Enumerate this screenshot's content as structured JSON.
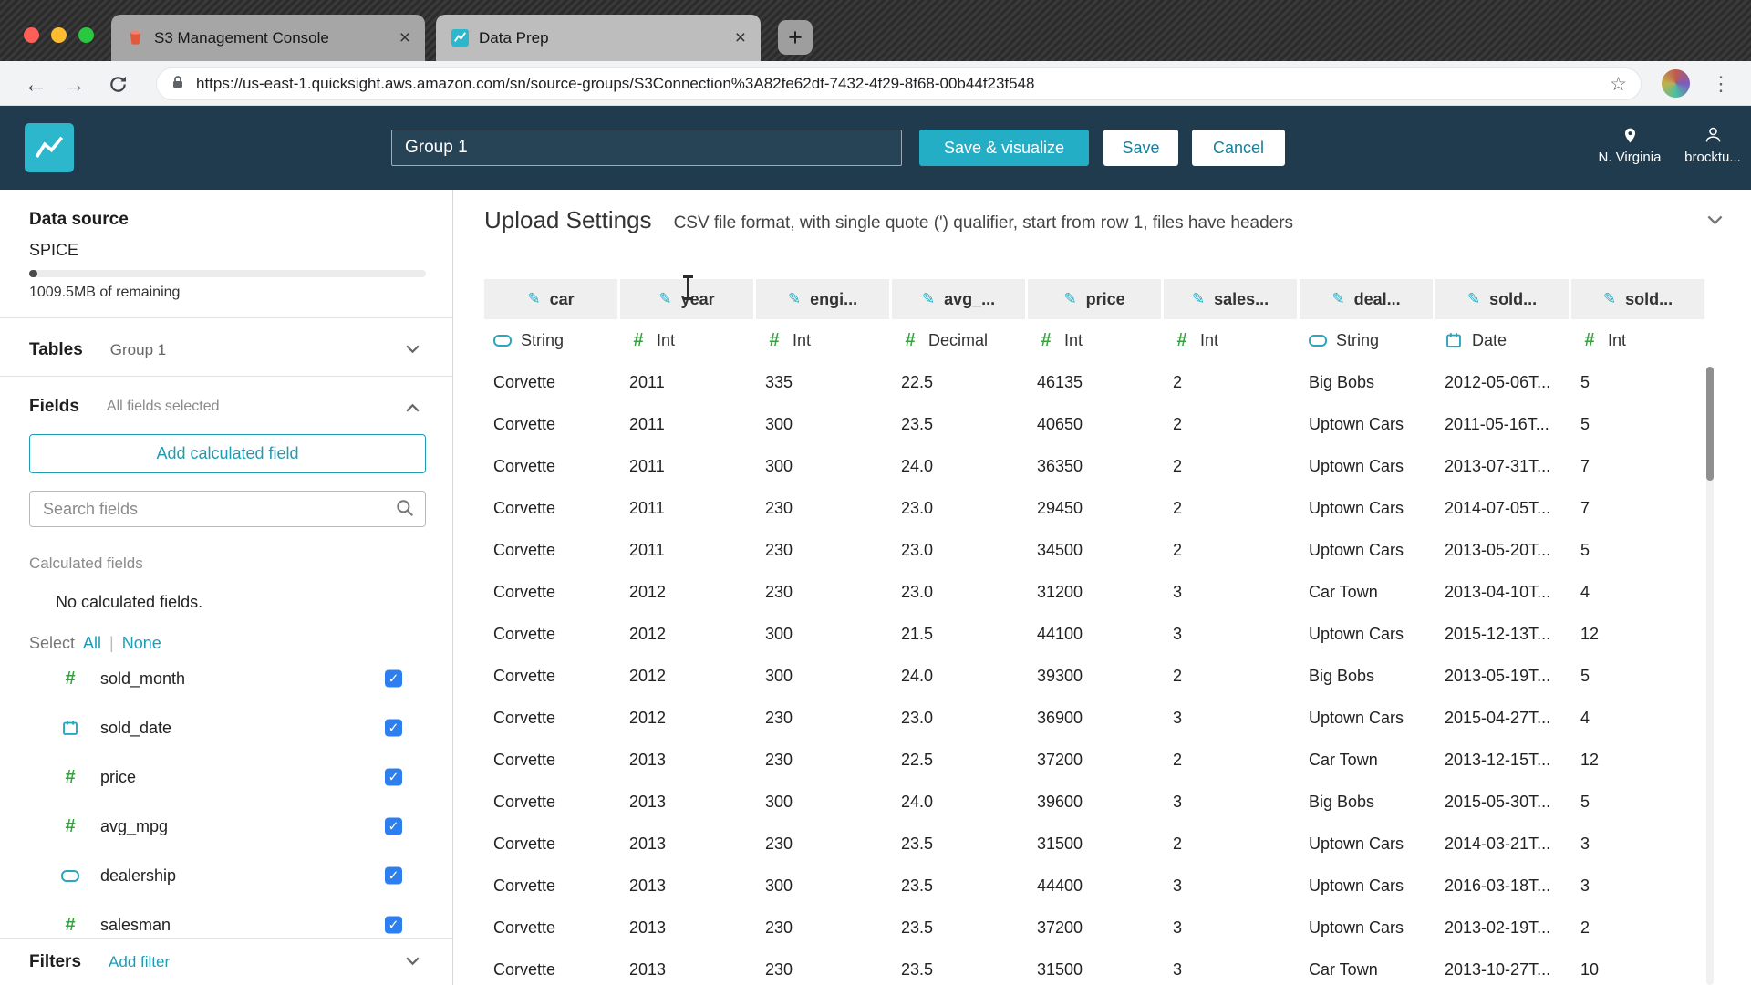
{
  "icons": {
    "close": "×",
    "plus": "+",
    "back": "←",
    "forward": "→",
    "kebab": "⋮",
    "star": "☆",
    "pencil": "✎",
    "check": "✓"
  },
  "browser": {
    "tabs": [
      {
        "label": "S3 Management Console"
      },
      {
        "label": "Data Prep"
      }
    ],
    "url": "https://us-east-1.quicksight.aws.amazon.com/sn/source-groups/S3Connection%3A82fe62df-7432-4f29-8f68-00b44f23f548"
  },
  "qs_header": {
    "group_name": "Group 1",
    "save_visualize": "Save & visualize",
    "save": "Save",
    "cancel": "Cancel",
    "region": "N. Virginia",
    "user": "brocktu..."
  },
  "sidebar": {
    "data_source_title": "Data source",
    "spice_label": "SPICE",
    "spice_remaining": "1009.5MB of remaining",
    "tables_label": "Tables",
    "tables_value": "Group 1",
    "fields_label": "Fields",
    "fields_status": "All fields selected",
    "add_calc_field": "Add calculated field",
    "search_placeholder": "Search fields",
    "calculated_fields_label": "Calculated fields",
    "no_calc_fields": "No calculated fields.",
    "select_label": "Select",
    "select_all": "All",
    "select_sep": "|",
    "select_none": "None",
    "fields": [
      {
        "name": "sold_month",
        "type": "int",
        "checked": true
      },
      {
        "name": "sold_date",
        "type": "date",
        "checked": true
      },
      {
        "name": "price",
        "type": "int",
        "checked": true
      },
      {
        "name": "avg_mpg",
        "type": "int",
        "checked": true
      },
      {
        "name": "dealership",
        "type": "string",
        "checked": true
      },
      {
        "name": "salesman",
        "type": "int",
        "checked": true
      }
    ],
    "filters_label": "Filters",
    "add_filter": "Add filter"
  },
  "main": {
    "title": "Upload Settings",
    "subtitle": "CSV file format, with single quote (') qualifier, start from row 1, files have headers",
    "table": {
      "columns": [
        {
          "label": "car",
          "type_label": "String",
          "type": "string"
        },
        {
          "label": "year",
          "type_label": "Int",
          "type": "int"
        },
        {
          "label": "engi...",
          "type_label": "Int",
          "type": "int"
        },
        {
          "label": "avg_...",
          "type_label": "Decimal",
          "type": "int"
        },
        {
          "label": "price",
          "type_label": "Int",
          "type": "int"
        },
        {
          "label": "sales...",
          "type_label": "Int",
          "type": "int"
        },
        {
          "label": "deal...",
          "type_label": "String",
          "type": "string"
        },
        {
          "label": "sold...",
          "type_label": "Date",
          "type": "date"
        },
        {
          "label": "sold...",
          "type_label": "Int",
          "type": "int"
        }
      ],
      "rows": [
        [
          "Corvette",
          "2011",
          "335",
          "22.5",
          "46135",
          "2",
          "Big Bobs",
          "2012-05-06T...",
          "5"
        ],
        [
          "Corvette",
          "2011",
          "300",
          "23.5",
          "40650",
          "2",
          "Uptown Cars",
          "2011-05-16T...",
          "5"
        ],
        [
          "Corvette",
          "2011",
          "300",
          "24.0",
          "36350",
          "2",
          "Uptown Cars",
          "2013-07-31T...",
          "7"
        ],
        [
          "Corvette",
          "2011",
          "230",
          "23.0",
          "29450",
          "2",
          "Uptown Cars",
          "2014-07-05T...",
          "7"
        ],
        [
          "Corvette",
          "2011",
          "230",
          "23.0",
          "34500",
          "2",
          "Uptown Cars",
          "2013-05-20T...",
          "5"
        ],
        [
          "Corvette",
          "2012",
          "230",
          "23.0",
          "31200",
          "3",
          "Car Town",
          "2013-04-10T...",
          "4"
        ],
        [
          "Corvette",
          "2012",
          "300",
          "21.5",
          "44100",
          "3",
          "Uptown Cars",
          "2015-12-13T...",
          "12"
        ],
        [
          "Corvette",
          "2012",
          "300",
          "24.0",
          "39300",
          "2",
          "Big Bobs",
          "2013-05-19T...",
          "5"
        ],
        [
          "Corvette",
          "2012",
          "230",
          "23.0",
          "36900",
          "3",
          "Uptown Cars",
          "2015-04-27T...",
          "4"
        ],
        [
          "Corvette",
          "2013",
          "230",
          "22.5",
          "37200",
          "2",
          "Car Town",
          "2013-12-15T...",
          "12"
        ],
        [
          "Corvette",
          "2013",
          "300",
          "24.0",
          "39600",
          "3",
          "Big Bobs",
          "2015-05-30T...",
          "5"
        ],
        [
          "Corvette",
          "2013",
          "230",
          "23.5",
          "31500",
          "2",
          "Uptown Cars",
          "2014-03-21T...",
          "3"
        ],
        [
          "Corvette",
          "2013",
          "300",
          "23.5",
          "44400",
          "3",
          "Uptown Cars",
          "2016-03-18T...",
          "3"
        ],
        [
          "Corvette",
          "2013",
          "230",
          "23.5",
          "37200",
          "3",
          "Uptown Cars",
          "2013-02-19T...",
          "2"
        ],
        [
          "Corvette",
          "2013",
          "230",
          "23.5",
          "31500",
          "3",
          "Car Town",
          "2013-10-27T...",
          "10"
        ]
      ]
    }
  }
}
